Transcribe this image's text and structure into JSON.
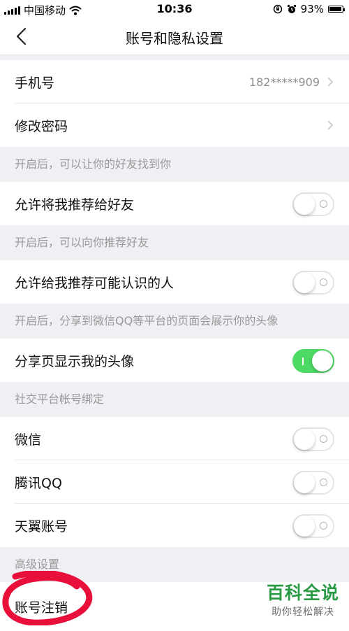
{
  "status_bar": {
    "carrier": "中国移动",
    "time": "10:36",
    "battery": "93%",
    "battery_level": 0.93
  },
  "nav": {
    "title": "账号和隐私设置",
    "back_icon": "chevron-left-icon"
  },
  "account": {
    "phone_label": "手机号",
    "phone_value": "182*****909",
    "password_label": "修改密码"
  },
  "sections": {
    "friend_find_hint": "开启后，可以让你的好友找到你",
    "recommend_me_label": "允许将我推荐给好友",
    "recommend_me_on": false,
    "recommend_to_me_hint": "开启后，可以向你推荐好友",
    "recommend_known_label": "允许给我推荐可能认识的人",
    "recommend_known_on": false,
    "avatar_hint": "开启后，分享到微信QQ等平台的页面会展示你的头像",
    "share_avatar_label": "分享页显示我的头像",
    "share_avatar_on": true,
    "social_binding_header": "社交平台帐号绑定",
    "wechat_label": "微信",
    "wechat_on": false,
    "qq_label": "腾讯QQ",
    "qq_on": false,
    "tianyi_label": "天翼账号",
    "tianyi_on": false,
    "advanced_header": "高级设置",
    "account_cancel_label": "账号注销"
  },
  "watermark": {
    "title": "百科全说",
    "subtitle": "助你轻松解决"
  },
  "colors": {
    "toggle_on": "#4cd964",
    "annotation": "#e8103a",
    "watermark": "#2a9a45"
  }
}
